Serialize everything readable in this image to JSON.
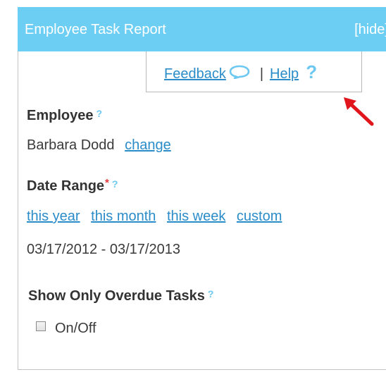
{
  "header": {
    "title": "Employee Task Report",
    "hide_label": "[hide]"
  },
  "help_bar": {
    "feedback_label": "Feedback",
    "separator": "|",
    "help_label": "Help",
    "help_icon": "?",
    "feedback_icon": "speech-bubble-icon"
  },
  "employee": {
    "label": "Employee",
    "help_icon": "?",
    "name": "Barbara Dodd",
    "change_label": "change"
  },
  "date_range": {
    "label": "Date Range",
    "required_mark": "*",
    "help_icon": "?",
    "options": [
      "this year",
      "this month",
      "this week",
      "custom"
    ],
    "value": "03/17/2012 - 03/17/2013"
  },
  "overdue": {
    "label": "Show Only Overdue Tasks",
    "help_icon": "?",
    "checkbox_label": "On/Off",
    "checked": false
  },
  "colors": {
    "header_bg": "#6dcef4",
    "link": "#2a8cc8",
    "help_icon": "#6cc8f0",
    "required": "#e6373a",
    "annotation_arrow": "#e0161c"
  }
}
